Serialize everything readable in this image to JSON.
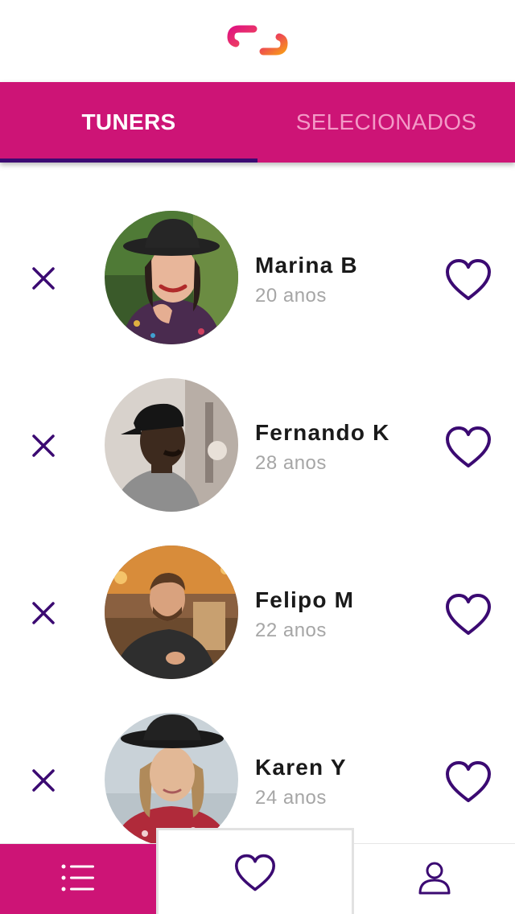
{
  "app": {
    "logo_icon": "chain-link-logo-icon",
    "colors": {
      "brand": "#cd1476",
      "accent": "#3b0a72",
      "tab_inactive": "#f39ac7",
      "age_text": "#a6a6a6"
    }
  },
  "tabs": [
    {
      "label": "TUNERS",
      "active": true
    },
    {
      "label": "SELECIONADOS",
      "active": false
    }
  ],
  "profiles": [
    {
      "name": "Marina B",
      "age": "20 anos",
      "dismiss_icon": "close-icon",
      "like_icon": "heart-outline-icon"
    },
    {
      "name": "Fernando K",
      "age": "28 anos",
      "dismiss_icon": "close-icon",
      "like_icon": "heart-outline-icon"
    },
    {
      "name": "Felipo M",
      "age": "22 anos",
      "dismiss_icon": "close-icon",
      "like_icon": "heart-outline-icon"
    },
    {
      "name": "Karen Y",
      "age": "24 anos",
      "dismiss_icon": "close-icon",
      "like_icon": "heart-outline-icon"
    }
  ],
  "bottom_nav": {
    "items": [
      {
        "icon": "list-icon",
        "active": true
      },
      {
        "icon": "heart-outline-icon",
        "active": false
      },
      {
        "icon": "user-icon",
        "active": false
      }
    ]
  }
}
